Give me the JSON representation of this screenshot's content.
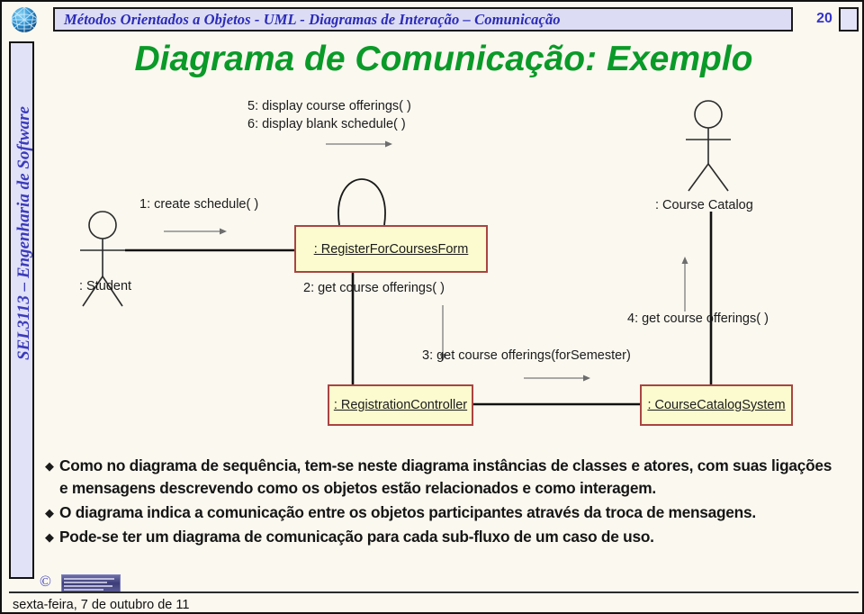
{
  "header": {
    "title": "Métodos Orientados a Objetos - UML - Diagramas de Interação – Comunicação",
    "slide_number": "20",
    "logo_icon": "blue-globe-logo-icon",
    "accent_color": "#2b2bb8",
    "bar_background": "#dcdcf5"
  },
  "left_rail": {
    "label": "SEL3113 – Engenharia de Software",
    "color": "#3b3bbb"
  },
  "slide": {
    "title": "Diagrama de Comunicação: Exemplo",
    "title_color": "#0a9a28",
    "background": "#faf8ef"
  },
  "diagram": {
    "type": "uml-communication-diagram",
    "actors": [
      {
        "id": "student",
        "label": ": Student"
      },
      {
        "id": "course_catalog",
        "label": ": Course Catalog"
      }
    ],
    "objects": [
      {
        "id": "register_form",
        "label": ": RegisterForCoursesForm"
      },
      {
        "id": "registration_controller",
        "label": ": RegistrationController"
      },
      {
        "id": "course_catalog_system",
        "label": ": CourseCatalogSystem"
      }
    ],
    "messages": [
      {
        "seq": "1",
        "label": "1: create schedule( )"
      },
      {
        "seq": "2",
        "label": "2: get course offerings( )"
      },
      {
        "seq": "3",
        "label": "3: get course offerings(forSemester)"
      },
      {
        "seq": "4",
        "label": "4: get course offerings( )"
      },
      {
        "seq": "5",
        "label": "5: display course offerings( )"
      },
      {
        "seq": "6",
        "label": "6: display blank schedule( )"
      }
    ],
    "object_fill": "#fbfbcf",
    "object_border": "#a94442"
  },
  "bullets": {
    "marker": "◆",
    "items": [
      "Como no diagrama de sequência, tem-se neste diagrama instâncias de classes e atores, com suas ligações e mensagens descrevendo como os objetos estão relacionados e como interagem.",
      "O diagrama indica a comunicação entre os objetos participantes através da troca de mensagens.",
      "Pode-se ter um diagrama de comunicação para cada sub-fluxo de um caso de uso."
    ]
  },
  "footer": {
    "copyright_symbol": "©",
    "date": "sexta-feira, 7 de outubro de 11"
  }
}
